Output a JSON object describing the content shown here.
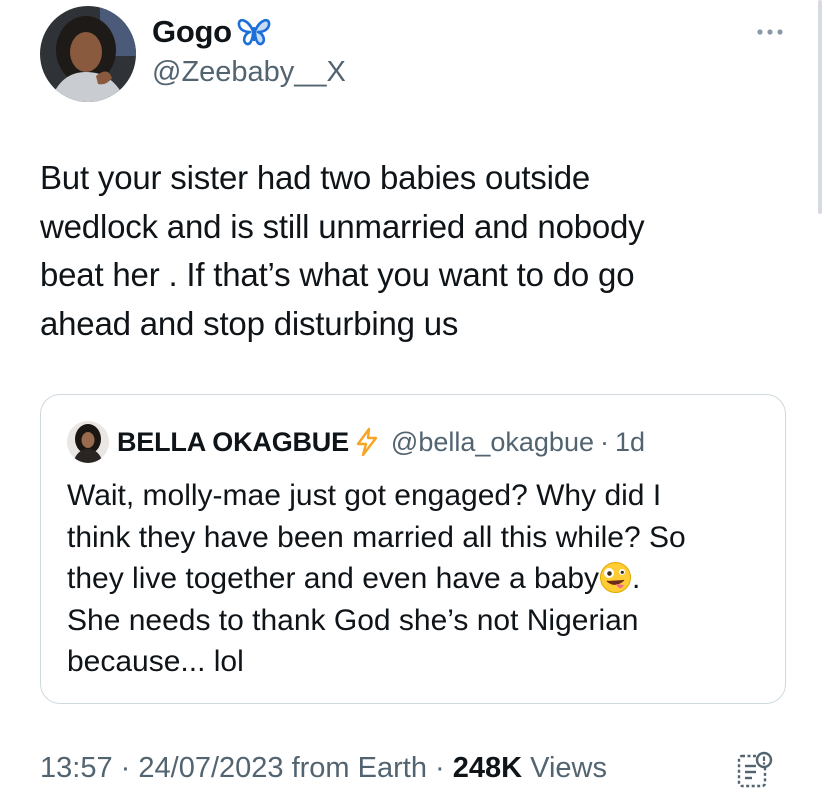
{
  "tweet": {
    "display_name": "Gogo",
    "handle": "@Zeebaby__X",
    "text": "But your sister had two babies outside\nwedlock and is still unmarried and nobody\nbeat her . If that’s what you want to do go\nahead and stop disturbing us",
    "time": "13:57",
    "date": "24/07/2023",
    "source": "from Earth",
    "views_count": "248K",
    "views_label": "Views",
    "separator": "·",
    "icons": {
      "name_badge": "butterfly-icon",
      "menu": "more-icon",
      "analytics": "analytics-icon"
    }
  },
  "quote": {
    "display_name": "BELLA OKAGBUE",
    "handle": "@bella_okagbue",
    "separator": "·",
    "time": "1d",
    "text_part1": "Wait, molly-mae just got engaged? Why did I\nthink they have been married all this while? So\nthey live together and even have a baby",
    "text_part2": ".\nShe needs to thank God she’s not Nigerian\nbecause... lol",
    "icons": {
      "name_badge": "lightning-bolt-icon",
      "emoji": "zany-face-emoji"
    }
  },
  "colors": {
    "text_primary": "#0f1419",
    "text_secondary": "#536471",
    "border": "#cfd9de",
    "butterfly": "#1d6fd8",
    "bolt": "#f5a623"
  }
}
